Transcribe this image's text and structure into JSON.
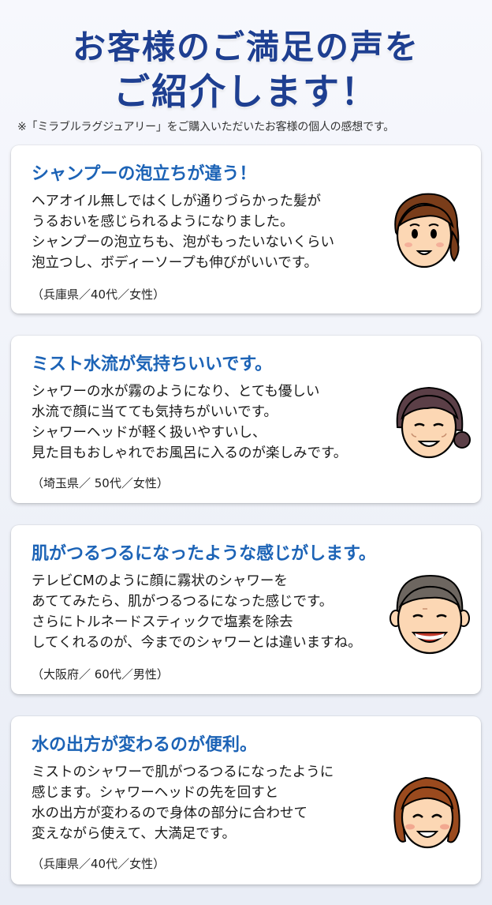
{
  "header": {
    "title_line1_a": "お客様",
    "title_line1_b": "の",
    "title_line1_c": "ご満足",
    "title_line1_d": "の",
    "title_line1_e": "声をご紹介します！",
    "title_line2": "ご紹介します！",
    "title_line1": "お客様のご満足の声を",
    "note": "※「ミラブルラグジュアリー」をご購入いただいたお客様の個人の感想です。"
  },
  "testimonials": [
    {
      "heading": "シャンプーの泡立ちが違う！",
      "lines": [
        "ヘアオイル無しではくしが通りづらかった髪が",
        "うるおいを感じられるようになりました。",
        "シャンプーの泡立ちも、泡がもったいないくらい",
        "泡立つし、ボディーソープも伸びがいいです。"
      ],
      "meta": "（兵庫県／40代／女性）",
      "avatar": "young-woman-icon"
    },
    {
      "heading": "ミスト水流が気持ちいいです。",
      "lines": [
        "シャワーの水が霧のようになり、とても優しい",
        "水流で顔に当てても気持ちがいいです。",
        "シャワーヘッドが軽く扱いやすいし、",
        "見た目もおしゃれでお風呂に入るのが楽しみです。"
      ],
      "meta": "（埼玉県／ 50代／女性）",
      "avatar": "middle-aged-woman-icon"
    },
    {
      "heading": "肌がつるつるになったような感じがします。",
      "lines": [
        "テレビCMのように顔に霧状のシャワーを",
        "あててみたら、肌がつるつるになった感じです。",
        "さらにトルネードスティックで塩素を除去",
        "してくれるのが、今までのシャワーとは違いますね。"
      ],
      "meta": "（大阪府／ 60代／男性）",
      "avatar": "senior-man-icon"
    },
    {
      "heading": "水の出方が変わるのが便利。",
      "lines": [
        "ミストのシャワーで肌がつるつるになったように",
        "感じます。シャワーヘッドの先を回すと",
        "水の出方が変わるので身体の部分に合わせて",
        "変えながら使えて、大満足です。"
      ],
      "meta": "（兵庫県／40代／女性）",
      "avatar": "smiling-woman-icon"
    }
  ],
  "colors": {
    "title": "#1e3f91",
    "heading": "#1c63b6"
  }
}
